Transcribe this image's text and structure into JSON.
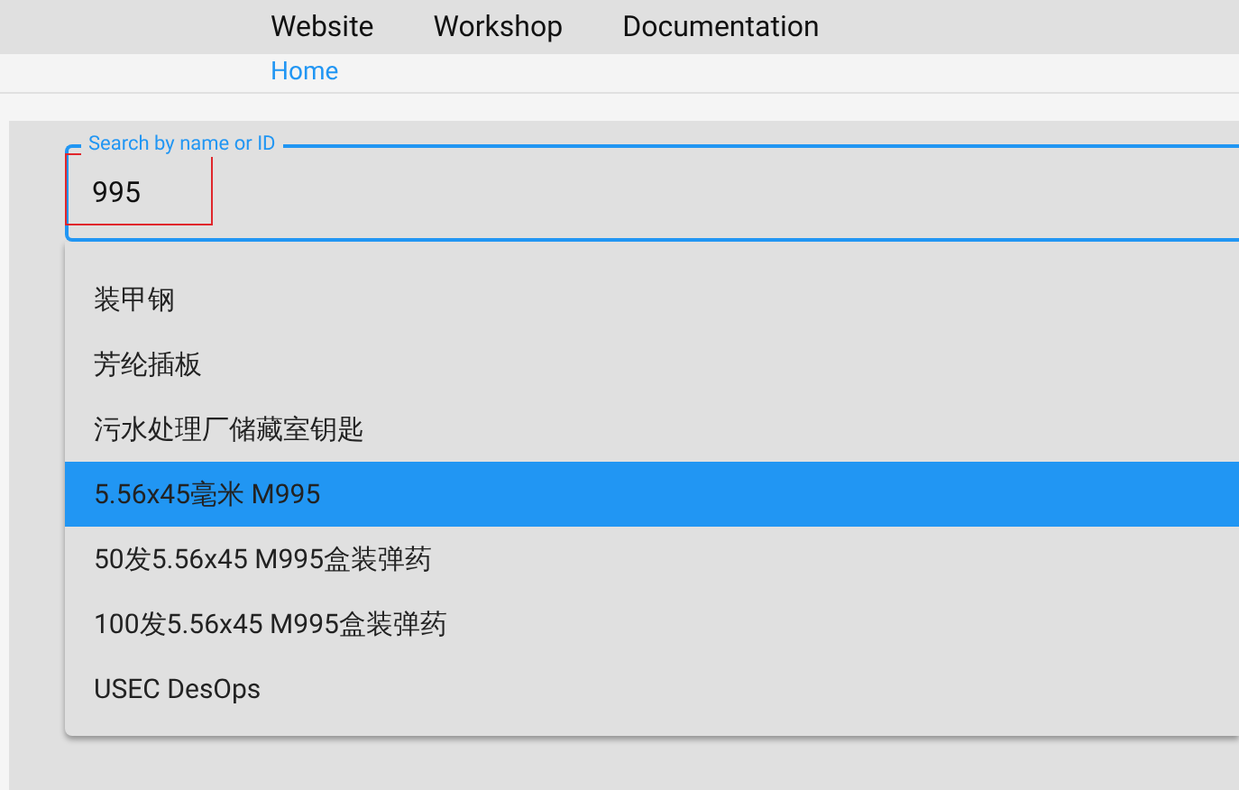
{
  "nav": {
    "links": [
      "Website",
      "Workshop",
      "Documentation"
    ]
  },
  "breadcrumb": [
    "Home"
  ],
  "search": {
    "label": "Search by name or ID",
    "value": "995"
  },
  "results": [
    {
      "label": "装甲钢",
      "selected": false
    },
    {
      "label": "芳纶插板",
      "selected": false
    },
    {
      "label": "污水处理厂储藏室钥匙",
      "selected": false
    },
    {
      "label": "5.56x45毫米 M995",
      "selected": true
    },
    {
      "label": "50发5.56x45 M995盒装弹药",
      "selected": false
    },
    {
      "label": "100发5.56x45 M995盒装弹药",
      "selected": false
    },
    {
      "label": "USEC DesOps",
      "selected": false
    }
  ]
}
